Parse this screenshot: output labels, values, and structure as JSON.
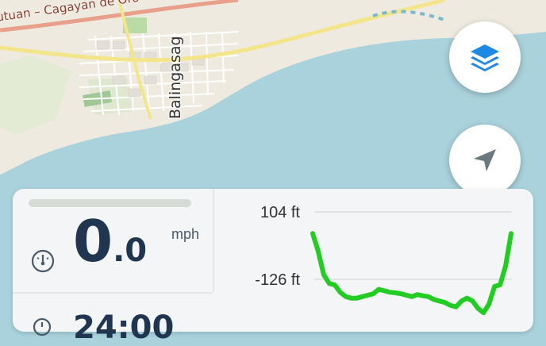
{
  "map": {
    "road_label": "utuan – Cagayan de Oro – Iligan",
    "town_label": "Balingasag"
  },
  "buttons": {
    "layers_icon": "layers-icon",
    "locate_icon": "navigation-arrow-icon"
  },
  "stats": {
    "speed_int": "0",
    "speed_dec": ".0",
    "speed_unit": "mph",
    "speed_icon": "speedometer-icon",
    "second_value": "24:00"
  },
  "colors": {
    "accent": "#1e88e5",
    "speed_text": "#1f3550",
    "elevation_line": "#22cc22",
    "water": "#a9d2dc",
    "land": "#eeeadf"
  },
  "chart_data": {
    "type": "line",
    "title": "",
    "xlabel": "",
    "ylabel": "",
    "ytick_labels": [
      "104 ft",
      "-126 ft"
    ],
    "yticks": [
      104,
      -126
    ],
    "grid": true,
    "series": [
      {
        "values": [
          30,
          -30,
          -110,
          -140,
          -145,
          -170,
          -185,
          -190,
          -190,
          -185,
          -180,
          -175,
          -160,
          -165,
          -170,
          -172,
          -175,
          -180,
          -185,
          -178,
          -182,
          -185,
          -195,
          -200,
          -205,
          -215,
          -220,
          -200,
          -190,
          -200,
          -225,
          -240,
          -210,
          -150,
          -145,
          -80,
          30
        ]
      }
    ]
  }
}
